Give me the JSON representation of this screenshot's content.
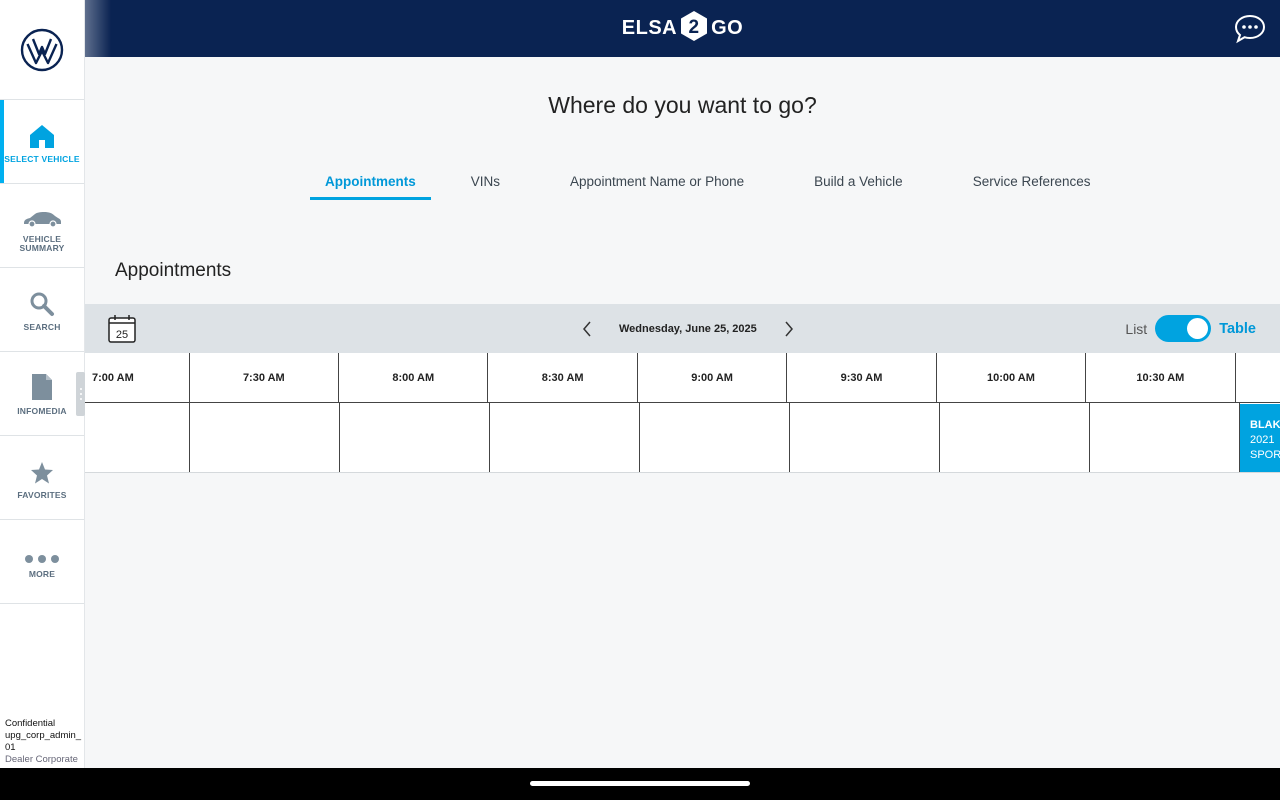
{
  "header": {
    "brand_left": "ELSA",
    "brand_num": "2",
    "brand_right": "GO"
  },
  "sidebar": {
    "items": [
      {
        "label": "SELECT VEHICLE",
        "icon": "home-icon",
        "active": true
      },
      {
        "label": "VEHICLE SUMMARY",
        "icon": "car-icon"
      },
      {
        "label": "SEARCH",
        "icon": "search-icon"
      },
      {
        "label": "INFOMEDIA",
        "icon": "document-icon"
      },
      {
        "label": "FAVORITES",
        "icon": "star-icon"
      },
      {
        "label": "MORE",
        "icon": "more-dots-icon"
      }
    ],
    "user": {
      "line1": "Confidential",
      "line2": "upg_corp_admin_01",
      "line3": "Dealer Corporate"
    }
  },
  "main": {
    "title": "Where do you want to go?",
    "tabs": [
      {
        "label": "Appointments",
        "active": true
      },
      {
        "label": "VINs"
      },
      {
        "label": "Appointment Name or Phone"
      },
      {
        "label": "Build a Vehicle"
      },
      {
        "label": "Service References"
      }
    ],
    "section_title": "Appointments"
  },
  "toolbar": {
    "calendar_day": "25",
    "date": "Wednesday, June 25, 2025",
    "view_list": "List",
    "view_table": "Table",
    "view_selected": "Table"
  },
  "schedule": {
    "times": [
      "7:00 AM",
      "7:30 AM",
      "8:00 AM",
      "8:30 AM",
      "9:00 AM",
      "9:30 AM",
      "10:00 AM",
      "10:30 AM"
    ],
    "appointment": {
      "name": "BLAK",
      "line2": "2021",
      "line3": "SPORT"
    }
  },
  "colors": {
    "header": "#0a2352",
    "accent": "#00a3e0",
    "toolbar": "#dde2e6"
  }
}
